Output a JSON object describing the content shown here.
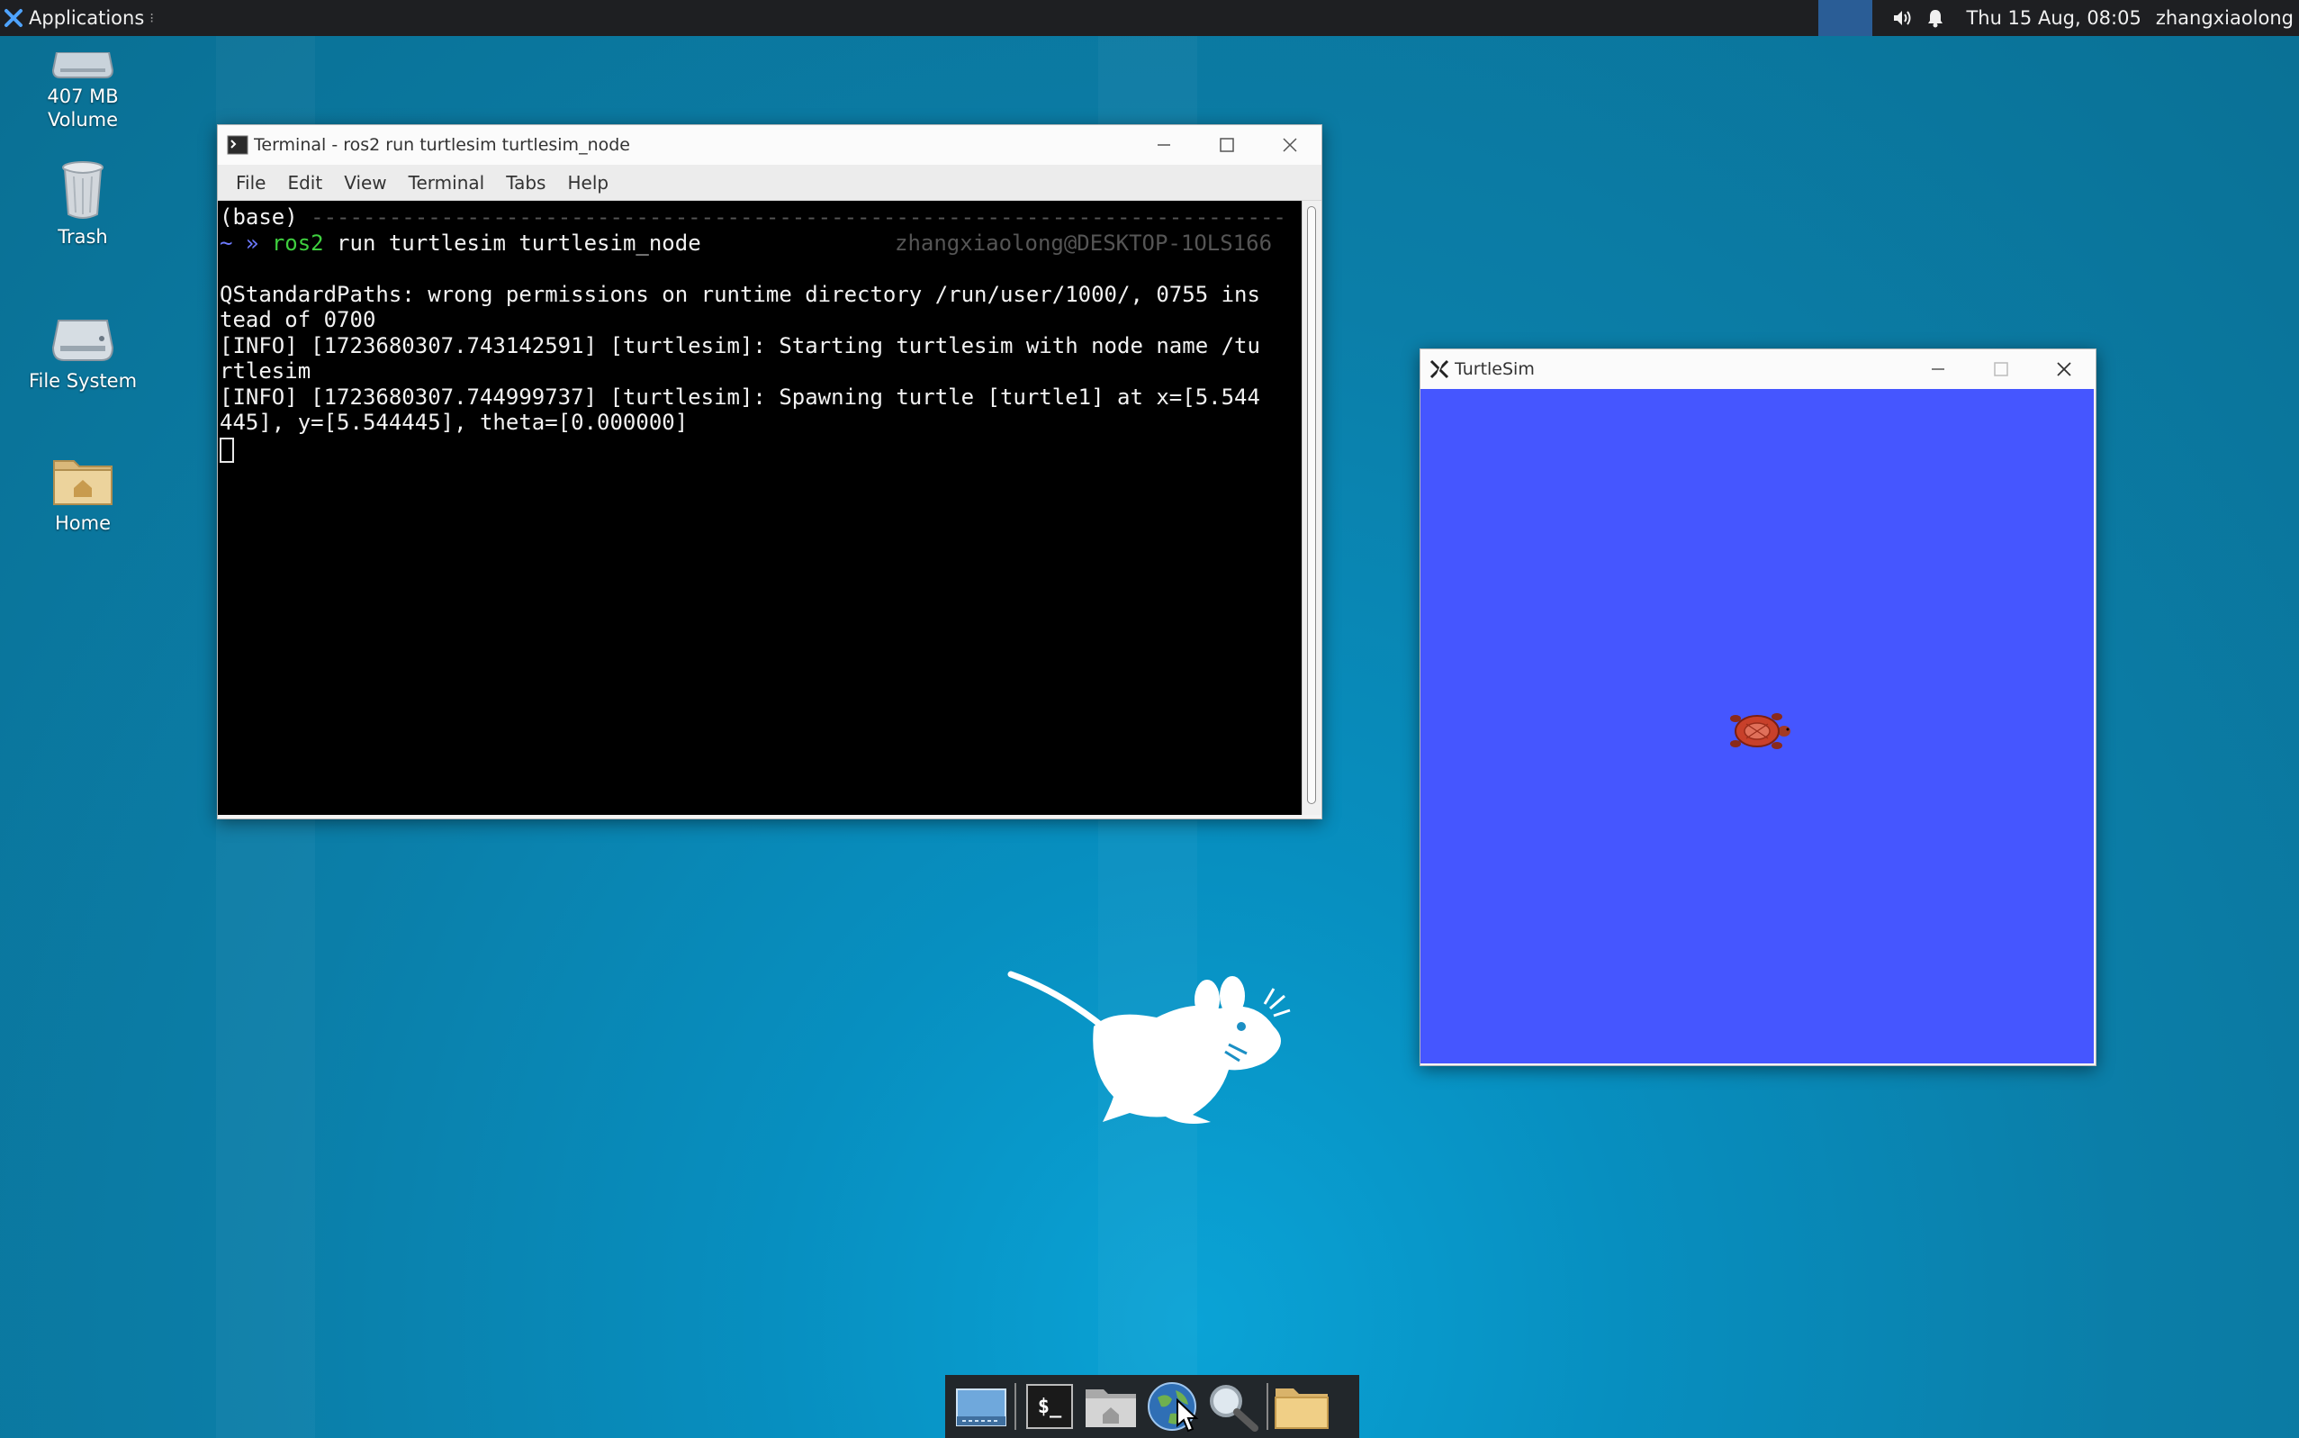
{
  "top_panel": {
    "applications_label": "Applications",
    "clock": "Thu 15 Aug, 08:05",
    "user": "zhangxiaolong"
  },
  "desktop_icons": [
    {
      "label": "407 MB\nVolume",
      "icon": "drive-icon"
    },
    {
      "label": "Trash",
      "icon": "trash-icon"
    },
    {
      "label": "File System",
      "icon": "drive-icon"
    },
    {
      "label": "Home",
      "icon": "home-folder-icon"
    }
  ],
  "terminal": {
    "title": "Terminal - ros2 run turtlesim turtlesim_node",
    "menu": [
      "File",
      "Edit",
      "View",
      "Terminal",
      "Tabs",
      "Help"
    ],
    "prompt_env": "(base)",
    "prompt_rule": " ---------------------------------------------------------------------------",
    "prompt_symbol": "~ »",
    "command_name": "ros2",
    "command_args": " run turtlesim turtlesim_node",
    "prompt_host": "zhangxiaolong@DESKTOP-1OLS166",
    "output_lines": [
      "QStandardPaths: wrong permissions on runtime directory /run/user/1000/, 0755 ins",
      "tead of 0700",
      "[INFO] [1723680307.743142591] [turtlesim]: Starting turtlesim with node name /tu",
      "rtlesim",
      "[INFO] [1723680307.744999737] [turtlesim]: Spawning turtle [turtle1] at x=[5.544",
      "445], y=[5.544445], theta=[0.000000]"
    ]
  },
  "turtlesim": {
    "title": "TurtleSim",
    "background_color": "#4556ff"
  },
  "dock": {
    "items": [
      "show-desktop-icon",
      "terminal-icon",
      "home-folder-icon",
      "web-browser-icon",
      "search-icon",
      "folder-icon"
    ],
    "terminal_glyph": "$_"
  }
}
